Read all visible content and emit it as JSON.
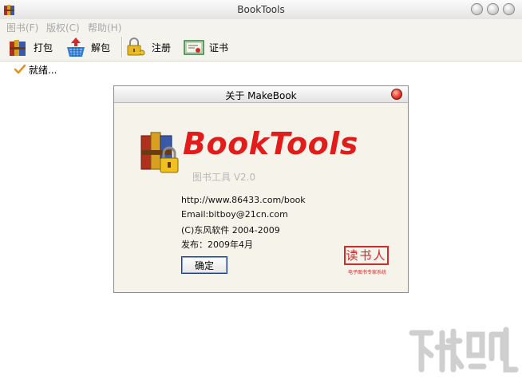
{
  "window": {
    "title": "BookTools"
  },
  "menu": [
    {
      "label": "图书(F)"
    },
    {
      "label": "版权(C)"
    },
    {
      "label": "帮助(H)"
    }
  ],
  "toolbar": [
    {
      "label": "打包",
      "icon": "pack-icon"
    },
    {
      "label": "解包",
      "icon": "unpack-basket-icon"
    },
    {
      "label": "注册",
      "icon": "register-lock-key-icon"
    },
    {
      "label": "证书",
      "icon": "certificate-icon"
    }
  ],
  "status": {
    "text": "就绪..."
  },
  "dialog": {
    "title": "关于 MakeBook",
    "brand": "BookTools",
    "subtitle": "图书工具  V2.0",
    "info": [
      "http://www.86433.com/book",
      "Email:bitboy@21cn.com",
      "(C)东风软件  2004-2009",
      "发布：2009年4月"
    ],
    "ok_label": "确定",
    "stamp": {
      "text": "读书人",
      "caption": "电子图书专家系统"
    }
  },
  "colors": {
    "brand": "#e21b1b",
    "stamp": "#d12a2a",
    "menu_disabled": "#a8a8a8",
    "dialog_bg": "#f6f4ea"
  }
}
